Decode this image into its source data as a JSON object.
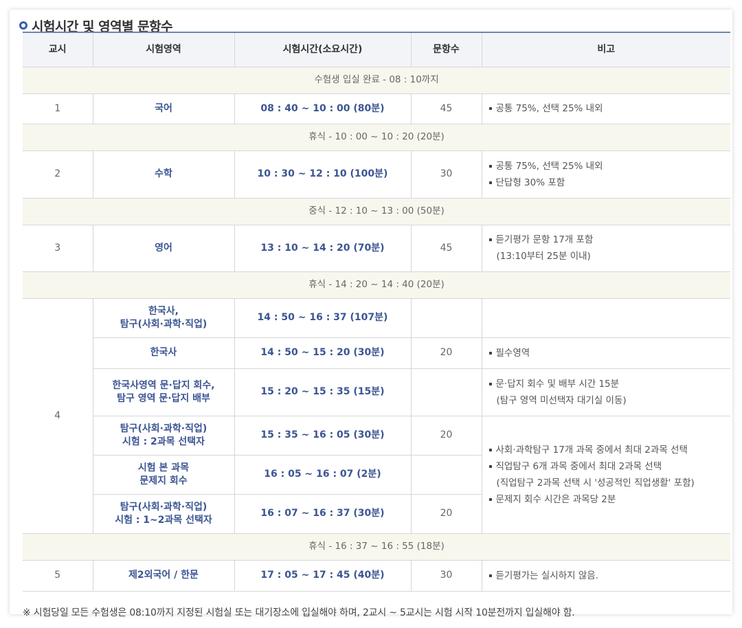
{
  "title": "시험시간 및 영역별 문항수",
  "headers": [
    "교시",
    "시험영역",
    "시험시간(소요시간)",
    "문항수",
    "비고"
  ],
  "rows": {
    "checkin": "수험생 입실 완료 - 08 : 10까지",
    "p1": {
      "period": "1",
      "subject": "국어",
      "time": "08 : 40 ~ 10 : 00 (80분)",
      "count": "45",
      "notes": [
        "공통 75%, 선택 25% 내외"
      ]
    },
    "break1": "휴식 - 10 : 00 ~ 10 : 20 (20분)",
    "p2": {
      "period": "2",
      "subject": "수학",
      "time": "10 : 30 ~ 12 : 10 (100분)",
      "count": "30",
      "notes": [
        "공통 75%, 선택 25% 내외",
        "단답형 30% 포함"
      ]
    },
    "lunch": "중식 - 12 : 10 ~ 13 : 00 (50분)",
    "p3": {
      "period": "3",
      "subject": "영어",
      "time": "13 : 10 ~ 14 : 20 (70분)",
      "count": "45",
      "notes": [
        "듣기평가 문항 17개 포함",
        "(13:10부터 25분 이내)"
      ]
    },
    "break2": "휴식 - 14 : 20 ~ 14 : 40 (20분)",
    "p4": {
      "period": "4",
      "a": {
        "subject_l1": "한국사,",
        "subject_l2": "탐구(사회·과학·직업)",
        "time": "14 : 50 ~ 16 : 37 (107분)"
      },
      "b": {
        "subject": "한국사",
        "time": "14 : 50 ~ 15 : 20 (30분)",
        "count": "20",
        "notes": [
          "필수영역"
        ]
      },
      "c": {
        "subject_l1": "한국사영역 문·답지 회수,",
        "subject_l2": "탐구 영역 문·답지 배부",
        "time": "15 : 20 ~ 15 : 35 (15분)",
        "notes": [
          "문·답지 회수 및 배부 시간 15분",
          "(탐구 영역 미선택자 대기실 이동)"
        ]
      },
      "d": {
        "subject_l1": "탐구(사회·과학·직업)",
        "subject_l2": "시험 : 2과목 선택자",
        "time": "15 : 35 ~ 16 : 05 (30분)",
        "count": "20"
      },
      "e": {
        "subject_l1": "시험 본 과목",
        "subject_l2": "문제지 회수",
        "time": "16 : 05 ~ 16 : 07 (2분)"
      },
      "f": {
        "subject_l1": "탐구(사회·과학·직업)",
        "subject_l2": "시험 : 1~2과목 선택자",
        "time": "16 : 07 ~ 16 : 37 (30분)",
        "count": "20"
      },
      "notes_def": [
        "사회·과학탐구 17개 과목 중에서 최대 2과목 선택",
        "직업탐구 6개 과목 중에서 최대 2과목 선택",
        "(직업탐구 2과목 선택 시 '성공적인 직업생활' 포함)",
        "문제지 회수 시간은 과목당 2분"
      ]
    },
    "break3": "휴식 - 16 : 37 ~ 16 : 55 (18분)",
    "p5": {
      "period": "5",
      "subject": "제2외국어 / 한문",
      "time": "17 : 05 ~ 17 : 45 (40분)",
      "count": "30",
      "notes": [
        "듣기평가는 실시하지 않음."
      ]
    }
  },
  "footnote": "※ 시험당일 모든 수험생은 08:10까지 지정된 시험실 또는 대기장소에 입실해야 하며, 2교시 ~ 5교시는 시험 시작 10분전까지 입실해야 함."
}
